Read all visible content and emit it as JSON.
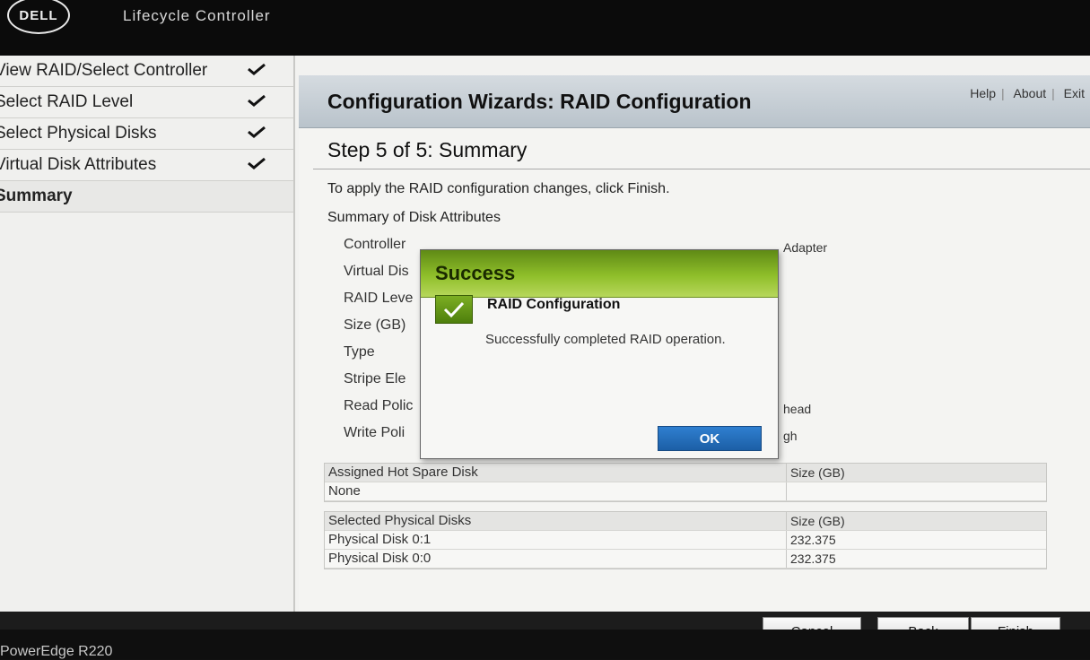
{
  "header": {
    "logo": "DELL",
    "app_title": "Lifecycle Controller"
  },
  "sidebar": {
    "items": [
      {
        "label": "View RAID/Select Controller",
        "done": true
      },
      {
        "label": "Select RAID Level",
        "done": true
      },
      {
        "label": "Select Physical Disks",
        "done": true
      },
      {
        "label": "Virtual Disk Attributes",
        "done": true
      },
      {
        "label": "Summary",
        "done": false
      }
    ]
  },
  "top_links": {
    "help": "Help",
    "about": "About",
    "exit": "Exit"
  },
  "main": {
    "title": "Configuration Wizards: RAID Configuration",
    "step_title": "Step 5 of 5: Summary",
    "instruction": "To apply the RAID configuration changes, click Finish.",
    "summary_heading": "Summary of Disk Attributes",
    "attributes": [
      {
        "label": "Controller",
        "value": "Adapter"
      },
      {
        "label": "Virtual Dis",
        "value": ""
      },
      {
        "label": "RAID Leve",
        "value": ""
      },
      {
        "label": "Size (GB)",
        "value": ""
      },
      {
        "label": "Type",
        "value": ""
      },
      {
        "label": "Stripe Ele",
        "value": ""
      },
      {
        "label": "Read Polic",
        "value": "head"
      },
      {
        "label": "Write Poli",
        "value": "gh"
      }
    ],
    "hot_spare_table": {
      "headers": [
        "Assigned Hot Spare Disk",
        "Size (GB)"
      ],
      "rows": [
        [
          "None",
          ""
        ]
      ]
    },
    "physical_table": {
      "headers": [
        "Selected Physical Disks",
        "Size (GB)"
      ],
      "rows": [
        [
          "Physical Disk 0:1",
          "232.375"
        ],
        [
          "Physical Disk 0:0",
          "232.375"
        ]
      ]
    }
  },
  "buttons": {
    "cancel": "Cancel",
    "back": "Back",
    "finish": "Finish"
  },
  "footer": {
    "model": "PowerEdge R220"
  },
  "dialog": {
    "title": "Success",
    "heading": "RAID Configuration",
    "message": "Successfully completed RAID operation.",
    "ok": "OK"
  }
}
